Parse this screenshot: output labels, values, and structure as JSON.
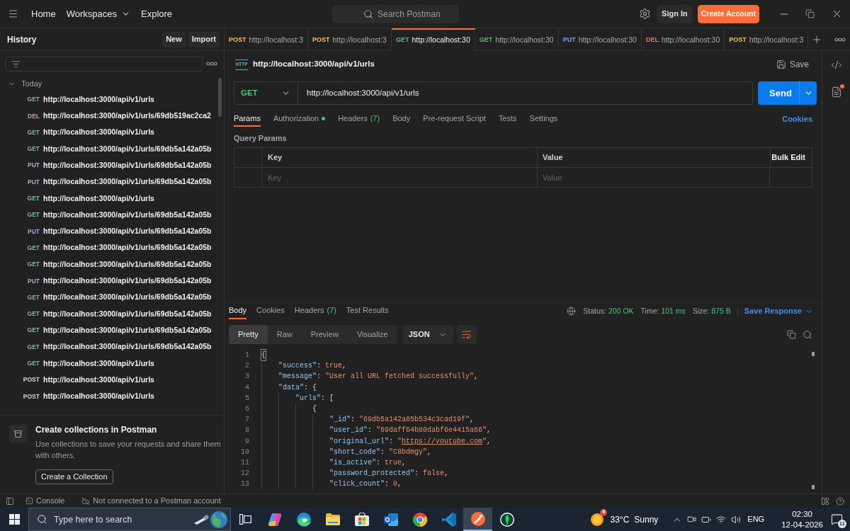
{
  "top_bar": {
    "nav": [
      {
        "label": "Home",
        "kind": "link"
      },
      {
        "label": "Workspaces",
        "kind": "dropdown"
      },
      {
        "label": "Explore",
        "kind": "link"
      }
    ],
    "search": {
      "placeholder": "Search Postman"
    },
    "sign_in": "Sign In",
    "create_account": "Create Account"
  },
  "sidebar": {
    "title": "History",
    "buttons": [
      "New",
      "Import"
    ],
    "groups": [
      {
        "label": "Today",
        "expanded": true,
        "items": [
          {
            "method": "GET",
            "color": "#7fb89c",
            "url": "http://localhost:3000/api/v1/urls"
          },
          {
            "method": "DEL",
            "color": "#c4a4a4",
            "url": "http://localhost:3000/api/v1/urls/69db519ac2ca2"
          },
          {
            "method": "GET",
            "color": "#7fb89c",
            "url": "http://localhost:3000/api/v1/urls"
          },
          {
            "method": "GET",
            "color": "#7fb89c",
            "url": "http://localhost:3000/api/v1/urls/69db5a142a05b"
          },
          {
            "method": "PUT",
            "color": "#9eb1d2",
            "url": "http://localhost:3000/api/v1/urls/69db5a142a05b"
          },
          {
            "method": "PUT",
            "color": "#9eb1d2",
            "url": "http://localhost:3000/api/v1/urls/69db5a142a05b"
          },
          {
            "method": "GET",
            "color": "#7fb89c",
            "url": "http://localhost:3000/api/v1/urls"
          },
          {
            "method": "GET",
            "color": "#7fb89c",
            "url": "http://localhost:3000/api/v1/urls/69db5a142a05b"
          },
          {
            "method": "PUT",
            "color": "#9eb1d2",
            "url": "http://localhost:3000/api/v1/urls/69db5a142a05b"
          },
          {
            "method": "GET",
            "color": "#7fb89c",
            "url": "http://localhost:3000/api/v1/urls/69db5a142a05b"
          },
          {
            "method": "GET",
            "color": "#7fb89c",
            "url": "http://localhost:3000/api/v1/urls/69db5a142a05b"
          },
          {
            "method": "PUT",
            "color": "#9eb1d2",
            "url": "http://localhost:3000/api/v1/urls/69db5a142a05b"
          },
          {
            "method": "GET",
            "color": "#7fb89c",
            "url": "http://localhost:3000/api/v1/urls/69db5a142a05b"
          },
          {
            "method": "GET",
            "color": "#7fb89c",
            "url": "http://localhost:3000/api/v1/urls/69db5a142a05b"
          },
          {
            "method": "GET",
            "color": "#7fb89c",
            "url": "http://localhost:3000/api/v1/urls/69db5a142a05b"
          },
          {
            "method": "GET",
            "color": "#7fb89c",
            "url": "http://localhost:3000/api/v1/urls/69db5a142a05b"
          },
          {
            "method": "GET",
            "color": "#7fb89c",
            "url": "http://localhost:3000/api/v1/urls"
          },
          {
            "method": "POST",
            "color": "#d6d6d6",
            "url": "http://localhost:3000/api/v1/urls"
          },
          {
            "method": "POST",
            "color": "#d6d6d6",
            "url": "http://localhost:3000/api/v1/urls"
          }
        ]
      }
    ],
    "promo": {
      "title": "Create collections in Postman",
      "text": "Use collections to save your requests and share them with others.",
      "button": "Create a Collection"
    }
  },
  "tabs": [
    {
      "method": "POST",
      "color": "#eec64f",
      "url": "http://localhost:3",
      "selected": false
    },
    {
      "method": "POST",
      "color": "#eec64f",
      "url": "http://localhost:3",
      "selected": false
    },
    {
      "method": "GET",
      "color": "#4cc17e",
      "url": "http://localhost:30",
      "selected": true
    },
    {
      "method": "GET",
      "color": "#4cc17e",
      "url": "http://localhost:30",
      "selected": false
    },
    {
      "method": "PUT",
      "color": "#6ea2f2",
      "url": "http://localhost:30",
      "selected": false
    },
    {
      "method": "DEL",
      "color": "#f0766c",
      "url": "http://localhost:30",
      "selected": false
    },
    {
      "method": "POST",
      "color": "#eec64f",
      "url": "http://localhost:3",
      "selected": false
    }
  ],
  "request": {
    "icon_label": "HTTP",
    "title": "http://localhost:3000/api/v1/urls",
    "save": "Save",
    "method": "GET",
    "url": "http://localhost:3000/api/v1/urls",
    "send": "Send",
    "tabs": [
      {
        "label": "Params",
        "selected": true
      },
      {
        "label": "Authorization",
        "dot": true,
        "selected": false
      },
      {
        "label": "Headers",
        "count": "(7)",
        "selected": false
      },
      {
        "label": "Body",
        "selected": false
      },
      {
        "label": "Pre-request Script",
        "selected": false
      },
      {
        "label": "Tests",
        "selected": false
      },
      {
        "label": "Settings",
        "selected": false
      }
    ],
    "cookies": "Cookies",
    "query_params": {
      "title": "Query Params",
      "columns": [
        "Key",
        "Value"
      ],
      "bulk_edit": "Bulk Edit",
      "placeholders": [
        "Key",
        "Value"
      ]
    }
  },
  "response": {
    "tabs": [
      {
        "label": "Body",
        "selected": true
      },
      {
        "label": "Cookies",
        "selected": false
      },
      {
        "label": "Headers",
        "count": "(7)",
        "selected": false
      },
      {
        "label": "Test Results",
        "selected": false
      }
    ],
    "stats": [
      {
        "label": "Status:",
        "value": "200 OK"
      },
      {
        "label": "Time:",
        "value": "101 ms"
      },
      {
        "label": "Size:",
        "value": "875 B"
      }
    ],
    "save_response": "Save Response",
    "views": [
      {
        "label": "Pretty",
        "selected": true
      },
      {
        "label": "Raw",
        "selected": false
      },
      {
        "label": "Preview",
        "selected": false
      },
      {
        "label": "Visualize",
        "selected": false
      }
    ],
    "format": "JSON",
    "wrap_lines": true,
    "code": [
      {
        "number": "1",
        "tokens": [
          {
            "kind": "punct",
            "text": "{",
            "matched": true
          }
        ],
        "children": [
          {
            "number": "2",
            "tokens": [
              {
                "kind": "key",
                "text": "\"success\""
              },
              {
                "kind": "punct",
                "text": ": "
              },
              {
                "kind": "literal",
                "text": "true"
              },
              {
                "kind": "punct",
                "text": ","
              }
            ]
          },
          {
            "number": "3",
            "tokens": [
              {
                "kind": "key",
                "text": "\"message\""
              },
              {
                "kind": "punct",
                "text": ": "
              },
              {
                "kind": "string",
                "text": "\"User all URL fetched successfully\""
              },
              {
                "kind": "punct",
                "text": ","
              }
            ]
          },
          {
            "number": "4",
            "tokens": [
              {
                "kind": "key",
                "text": "\"data\""
              },
              {
                "kind": "punct",
                "text": ": {"
              }
            ],
            "children": [
              {
                "number": "5",
                "tokens": [
                  {
                    "kind": "key",
                    "text": "\"urls\""
                  },
                  {
                    "kind": "punct",
                    "text": ": ["
                  }
                ],
                "children": [
                  {
                    "number": "6",
                    "tokens": [
                      {
                        "kind": "punct",
                        "text": "{"
                      }
                    ],
                    "children": [
                      {
                        "number": "7",
                        "tokens": [
                          {
                            "kind": "key",
                            "text": "\"_id\""
                          },
                          {
                            "kind": "punct",
                            "text": ": "
                          },
                          {
                            "kind": "string",
                            "text": "\"69db5a142a05b534c3cad19f\""
                          },
                          {
                            "kind": "punct",
                            "text": ","
                          }
                        ]
                      },
                      {
                        "number": "8",
                        "tokens": [
                          {
                            "kind": "key",
                            "text": "\"user_id\""
                          },
                          {
                            "kind": "punct",
                            "text": ": "
                          },
                          {
                            "kind": "string",
                            "text": "\"69daff64b80dabf6e4415a66\""
                          },
                          {
                            "kind": "punct",
                            "text": ","
                          }
                        ]
                      },
                      {
                        "number": "9",
                        "tokens": [
                          {
                            "kind": "key",
                            "text": "\"original_url\""
                          },
                          {
                            "kind": "punct",
                            "text": ": "
                          },
                          {
                            "kind": "string",
                            "text": "\""
                          },
                          {
                            "kind": "link",
                            "text": "https://youtube.com"
                          },
                          {
                            "kind": "string",
                            "text": "\""
                          },
                          {
                            "kind": "punct",
                            "text": ","
                          }
                        ]
                      },
                      {
                        "number": "10",
                        "tokens": [
                          {
                            "kind": "key",
                            "text": "\"short_code\""
                          },
                          {
                            "kind": "punct",
                            "text": ": "
                          },
                          {
                            "kind": "string",
                            "text": "\"C8bdmgy\""
                          },
                          {
                            "kind": "punct",
                            "text": ","
                          }
                        ]
                      },
                      {
                        "number": "11",
                        "tokens": [
                          {
                            "kind": "key",
                            "text": "\"is_active\""
                          },
                          {
                            "kind": "punct",
                            "text": ": "
                          },
                          {
                            "kind": "literal",
                            "text": "true"
                          },
                          {
                            "kind": "punct",
                            "text": ","
                          }
                        ]
                      },
                      {
                        "number": "12",
                        "tokens": [
                          {
                            "kind": "key",
                            "text": "\"password_protected\""
                          },
                          {
                            "kind": "punct",
                            "text": ": "
                          },
                          {
                            "kind": "literal",
                            "text": "false"
                          },
                          {
                            "kind": "punct",
                            "text": ","
                          }
                        ]
                      },
                      {
                        "number": "13",
                        "tokens": [
                          {
                            "kind": "key",
                            "text": "\"click_count\""
                          },
                          {
                            "kind": "punct",
                            "text": ": "
                          },
                          {
                            "kind": "literal",
                            "text": "0"
                          },
                          {
                            "kind": "punct",
                            "text": ","
                          }
                        ]
                      }
                    ]
                  }
                ]
              }
            ]
          }
        ]
      }
    ]
  },
  "status_bar": {
    "console": "Console",
    "connection": "Not connected to a Postman account"
  },
  "taskbar": {
    "search": {
      "placeholder": "Type here to search"
    },
    "apps": [
      {
        "kind": "task_view",
        "selected": false
      },
      {
        "kind": "copilot",
        "selected": false
      },
      {
        "kind": "edge",
        "selected": false
      },
      {
        "kind": "explorer",
        "selected": false
      },
      {
        "kind": "store",
        "selected": false
      },
      {
        "kind": "outlook",
        "selected": false
      },
      {
        "kind": "chrome",
        "selected": false
      },
      {
        "kind": "vscode",
        "selected": false
      },
      {
        "kind": "postman",
        "selected": true
      },
      {
        "kind": "mongodb",
        "selected": false
      }
    ],
    "weather": {
      "badge": "6",
      "temperature": "33°C",
      "condition": "Sunny"
    },
    "language": "ENG",
    "time": "02:30",
    "date": "12-04-2026",
    "notifications": "11"
  }
}
